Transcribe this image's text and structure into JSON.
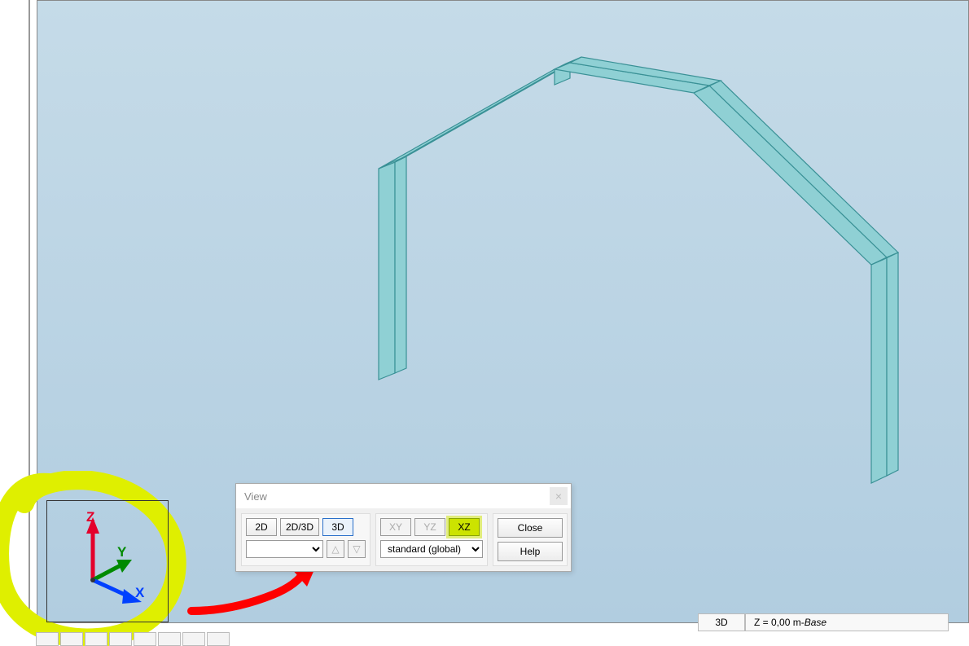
{
  "dialog": {
    "title": "View",
    "close_glyph": "×",
    "btn_2d": "2D",
    "btn_2d3d": "2D/3D",
    "btn_3d": "3D",
    "btn_xy": "XY",
    "btn_yz": "YZ",
    "btn_xz": "XZ",
    "empty_select": "",
    "tri_up": "△",
    "tri_down": "▽",
    "cs_select": "standard (global)",
    "close": "Close",
    "help": "Help"
  },
  "triad": {
    "z": "Z",
    "y": "Y",
    "x": "X"
  },
  "status": {
    "mode": "3D",
    "z_label": "Z = 0,00 m",
    "dash": " - ",
    "layer": "Base"
  },
  "colors": {
    "beam_fill": "#8fd0d4",
    "beam_edge": "#3a9196",
    "highlight": "#dfef00"
  }
}
